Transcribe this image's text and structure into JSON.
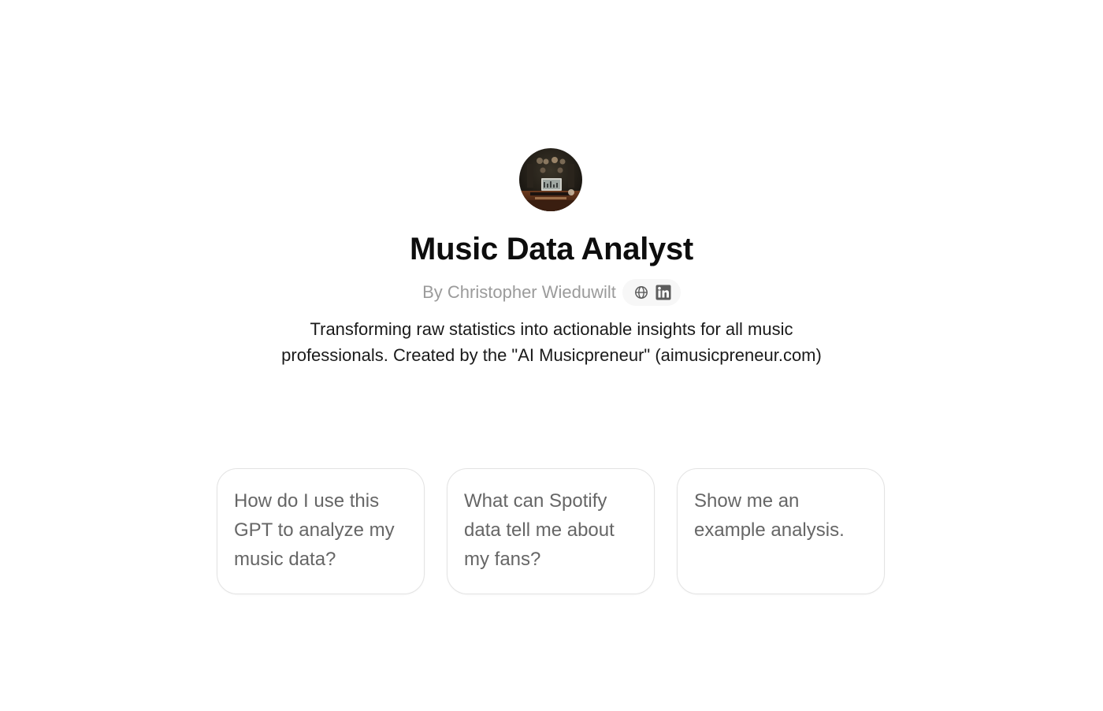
{
  "gpt": {
    "avatar_icon": "music-studio-avatar",
    "title": "Music Data Analyst",
    "author": "By Christopher Wieduwilt",
    "social_icons": [
      "globe-icon",
      "linkedin-icon"
    ],
    "description": "Transforming raw statistics into actionable insights for all music professionals. Created by the \"AI Musicpreneur\" (aimusicpreneur.com)"
  },
  "prompts": [
    {
      "text": "How do I use this GPT to analyze my music data?"
    },
    {
      "text": "What can Spotify data tell me about my fans?"
    },
    {
      "text": "Show me an example analysis."
    }
  ],
  "colors": {
    "title": "#0d0d0d",
    "byline": "#9b9b9b",
    "prompt_text": "#666666",
    "card_border": "#e3e3e3"
  }
}
